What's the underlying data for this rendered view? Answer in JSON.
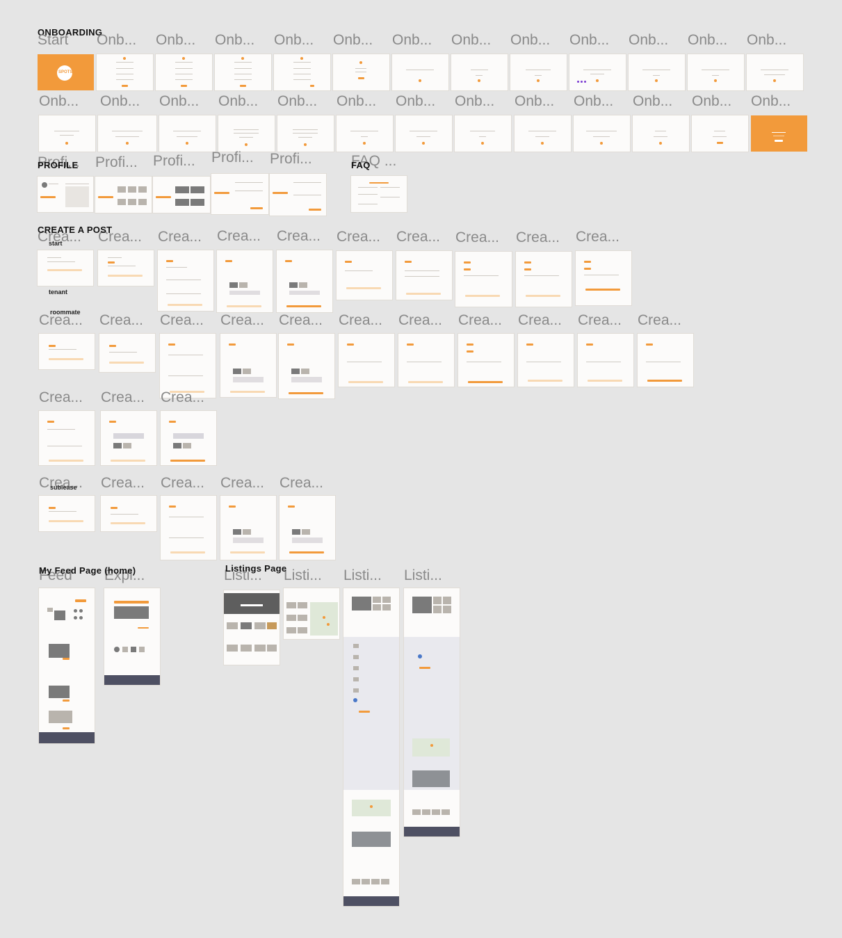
{
  "sections": {
    "onboarding": "ONBOARDING",
    "profile": "PROFILE",
    "faq": "FAQ",
    "create_post": "CREATE A POST",
    "create_start": "start",
    "create_tenant": "tenant",
    "create_roommate": "roommate",
    "create_sublease": "sublease",
    "feed": "My Feed Page (home)",
    "listings": "Listings Page"
  },
  "frame_titles": {
    "start": "Start",
    "onb": "Onb...",
    "profi": "Profi...",
    "faq": "FAQ ...",
    "crea": "Crea...",
    "feed": "Feed",
    "expl": "Expl...",
    "listi": "Listi..."
  },
  "brand": {
    "logo_text": "SPOTS",
    "accent": "#f29a3b"
  }
}
